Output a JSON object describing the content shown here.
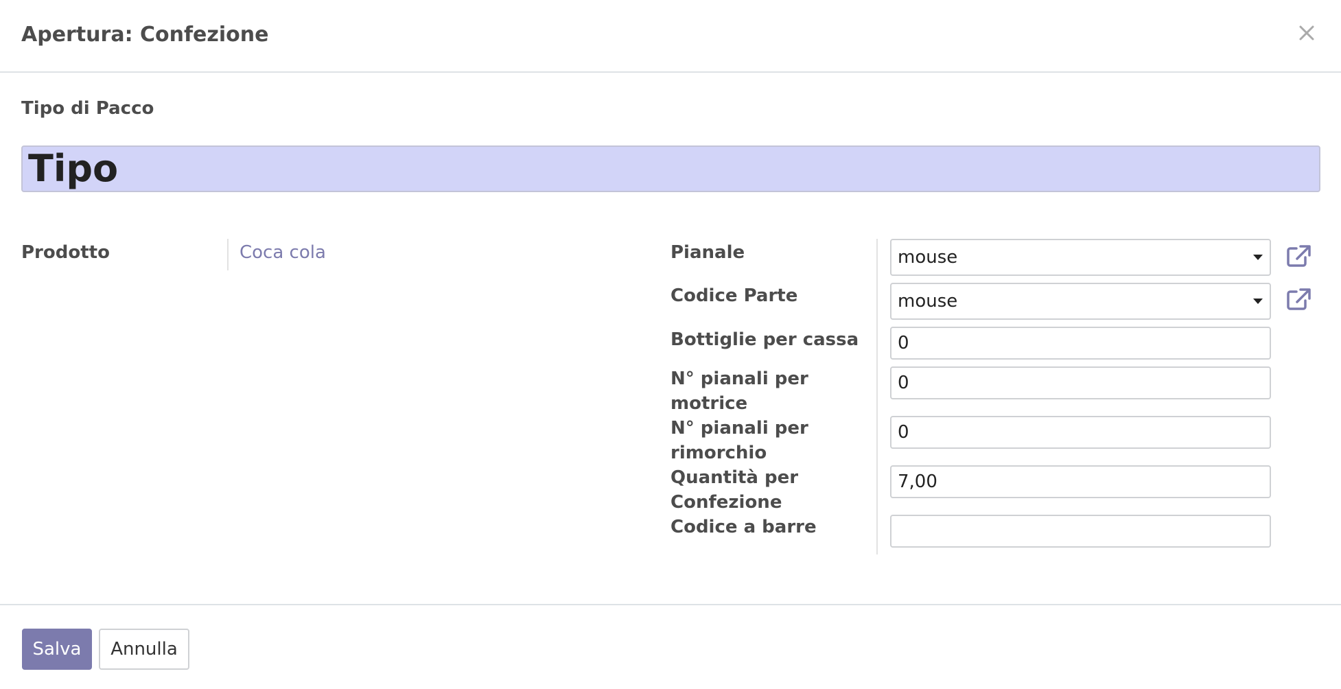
{
  "dialog": {
    "title": "Apertura: Confezione",
    "close_icon": "close-icon"
  },
  "form": {
    "sheet_label": "Tipo di Pacco",
    "name_value": "Tipo",
    "left": {
      "product_label": "Prodotto",
      "product_value": "Coca cola"
    },
    "right": {
      "pallet_label": "Pianale",
      "pallet_value": "mouse",
      "part_code_label": "Codice Parte",
      "part_code_value": "mouse",
      "bottles_label": "Bottiglie per cassa",
      "bottles_value": "0",
      "pallets_truck_label_line1": "N° pianali per",
      "pallets_truck_label_line2": "motrice",
      "pallets_truck_value": "0",
      "pallets_trailer_label_line1": "N° pianali per",
      "pallets_trailer_label_line2": "rimorchio",
      "pallets_trailer_value": "0",
      "qty_label_line1": "Quantità per",
      "qty_label_line2": "Confezione",
      "qty_value": "7,00",
      "barcode_label": "Codice a barre",
      "barcode_value": ""
    },
    "external_link_icon": "external-link-icon"
  },
  "footer": {
    "save_label": "Salva",
    "cancel_label": "Annulla"
  },
  "colors": {
    "primary": "#7c7bad",
    "name_field_bg": "#d2d4f8",
    "link": "#7c7bad"
  }
}
